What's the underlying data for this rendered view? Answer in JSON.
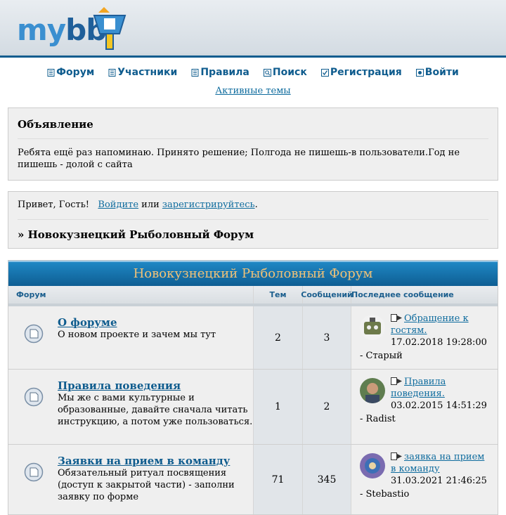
{
  "header": {
    "logo_text": "mybb"
  },
  "nav": {
    "items": [
      {
        "label": "Форум",
        "icon": "document-icon"
      },
      {
        "label": "Участники",
        "icon": "members-icon"
      },
      {
        "label": "Правила",
        "icon": "rules-icon"
      },
      {
        "label": "Поиск",
        "icon": "search-icon"
      },
      {
        "label": "Регистрация",
        "icon": "register-icon"
      },
      {
        "label": "Войти",
        "icon": "login-icon"
      }
    ],
    "active_topics": "Активные темы"
  },
  "announcement": {
    "title": "Объявление",
    "text": "Ребята ещё раз напоминаю. Принято решение; Полгода не пишешь-в пользователи.Год не пишешь - долой с сайта"
  },
  "welcome": {
    "greeting": "Привет, Гость!",
    "login_link": "Войдите",
    "or": "или",
    "register_link": "зарегистрируйтесь",
    "period": ".",
    "breadcrumb_prefix": "»",
    "breadcrumb": "Новокузнецкий Рыболовный Форум"
  },
  "forum": {
    "title": "Новокузнецкий Рыболовный Форум",
    "columns": {
      "forum": "Форум",
      "topics": "Тем",
      "posts": "Сообщений",
      "last_post": "Последнее сообщение"
    },
    "rows": [
      {
        "name": "О форуме",
        "desc": "О новом проекте и зачем мы тут",
        "topics": "2",
        "posts": "3",
        "last_title": "Обращение к гостям.",
        "last_date": "17.02.2018 19:28:00",
        "last_author": "- Старый"
      },
      {
        "name": "Правила поведения",
        "desc": "Мы же с вами культурные и образованные, давайте сначала читать инструкцию, а потом уже пользоваться.",
        "topics": "1",
        "posts": "2",
        "last_title": "Правила поведения.",
        "last_date": "03.02.2015 14:51:29",
        "last_author": "- Radist"
      },
      {
        "name": "Заявки на прием в команду",
        "desc": "Обязательный ритуал посвящения (доступ к закрытой части) - заполни заявку по форме",
        "topics": "71",
        "posts": "345",
        "last_title": "заявка на прием в команду",
        "last_date": "31.03.2021 21:46:25",
        "last_author": "- Stebastio"
      }
    ]
  },
  "colors": {
    "link": "#0f5c8e",
    "title_bar": "#1478b4",
    "title_text": "#f0c278"
  }
}
